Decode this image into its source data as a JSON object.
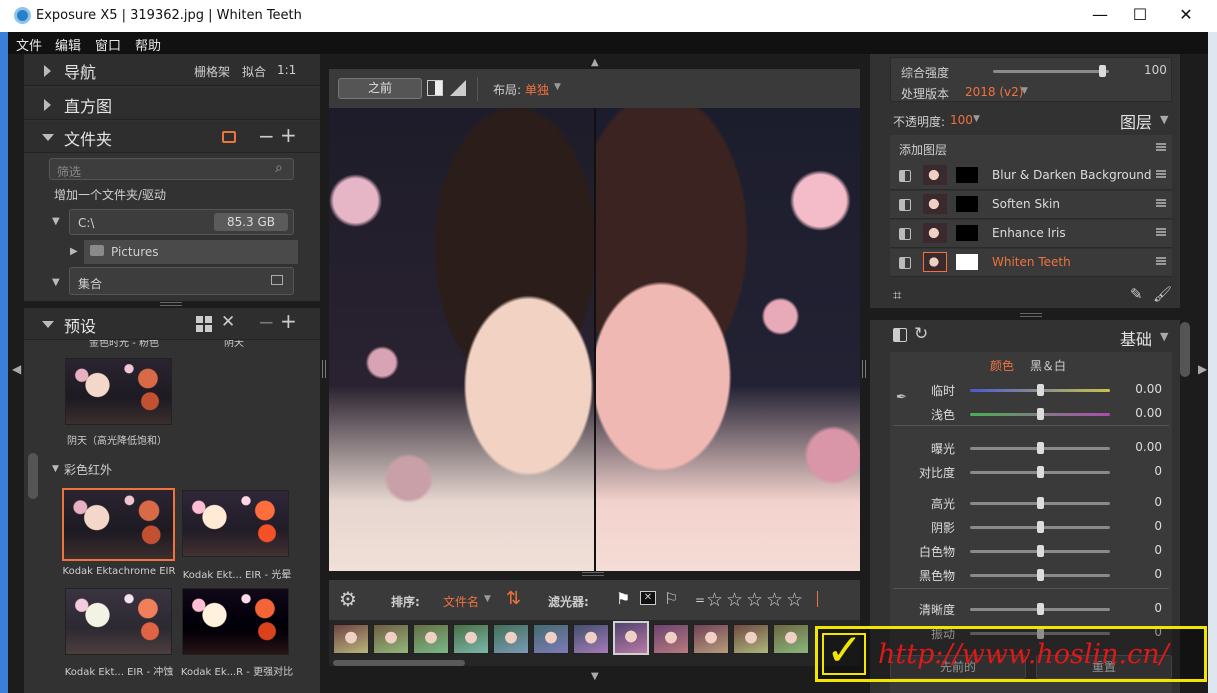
{
  "window": {
    "title": "Exposure X5 | 319362.jpg | Whiten Teeth",
    "min": "—",
    "max": "☐",
    "close": "✕"
  },
  "menu": [
    "文件",
    "编辑",
    "窗口",
    "帮助"
  ],
  "left_panel": {
    "navigate": {
      "title": "导航",
      "grid": "栅格架",
      "fit": "拟合",
      "one": "1:1"
    },
    "histogram": {
      "title": "直方图"
    },
    "folders": {
      "title": "文件夹",
      "filter_placeholder": "筛选",
      "add_folder": "增加一个文件夹/驱动",
      "drive": "C:\\",
      "drive_size": "85.3 GB",
      "pictures": "Pictures",
      "collections": "集合"
    },
    "presets": {
      "title": "预设",
      "prev_caption_top": "金色时光 - 粉色",
      "prev_caption_top2": "阴天",
      "cloudy_caption": "阴天（高光降低饱和）",
      "group": "彩色红外",
      "items": [
        "Kodak Ektachrome EIR",
        "Kodak Ekt... EIR - 光晕",
        "Kodak Ekt... EIR - 冲蚀",
        "Kodak Ek...R - 更强对比"
      ]
    }
  },
  "center": {
    "before_btn": "之前",
    "layout_label": "布局:",
    "layout_value": "单独",
    "sort_label": "排序:",
    "sort_value": "文件名",
    "filter_label": "滤光器:",
    "equals": "=",
    "stars": [
      "☆",
      "☆",
      "☆",
      "☆",
      "☆"
    ]
  },
  "right_panel": {
    "overall": {
      "label": "综合强度",
      "value": "100",
      "fraction": 0.95
    },
    "process": {
      "label": "处理版本",
      "value": "2018 (v2)"
    },
    "opacity": {
      "label": "不透明度:",
      "value": "100"
    },
    "layers_title": "图层",
    "add_layer": "添加图层",
    "layers": [
      {
        "name": "Blur & Darken Background",
        "active": false
      },
      {
        "name": "Soften Skin",
        "active": false
      },
      {
        "name": "Enhance Iris",
        "active": false
      },
      {
        "name": "Whiten Teeth",
        "active": true
      }
    ],
    "basic_title": "基础",
    "color_tab": "颜色",
    "bw_tab": "黑＆白",
    "sliders": [
      {
        "label": "临时",
        "value": "0.00"
      },
      {
        "label": "浅色",
        "value": "0.00"
      },
      {
        "label": "曝光",
        "value": "0.00"
      },
      {
        "label": "对比度",
        "value": "0"
      },
      {
        "label": "高光",
        "value": "0"
      },
      {
        "label": "阴影",
        "value": "0"
      },
      {
        "label": "白色物",
        "value": "0"
      },
      {
        "label": "黑色物",
        "value": "0"
      },
      {
        "label": "清晰度",
        "value": "0"
      },
      {
        "label": "振动",
        "value": "0"
      }
    ],
    "prev_btn": "先前的",
    "reset_btn": "重置"
  },
  "watermark": {
    "url": "http://www.hoslin.cn/"
  },
  "colors": {
    "accent": "#f0723c",
    "panel": "#323232",
    "bg": "#1b1b1b"
  }
}
